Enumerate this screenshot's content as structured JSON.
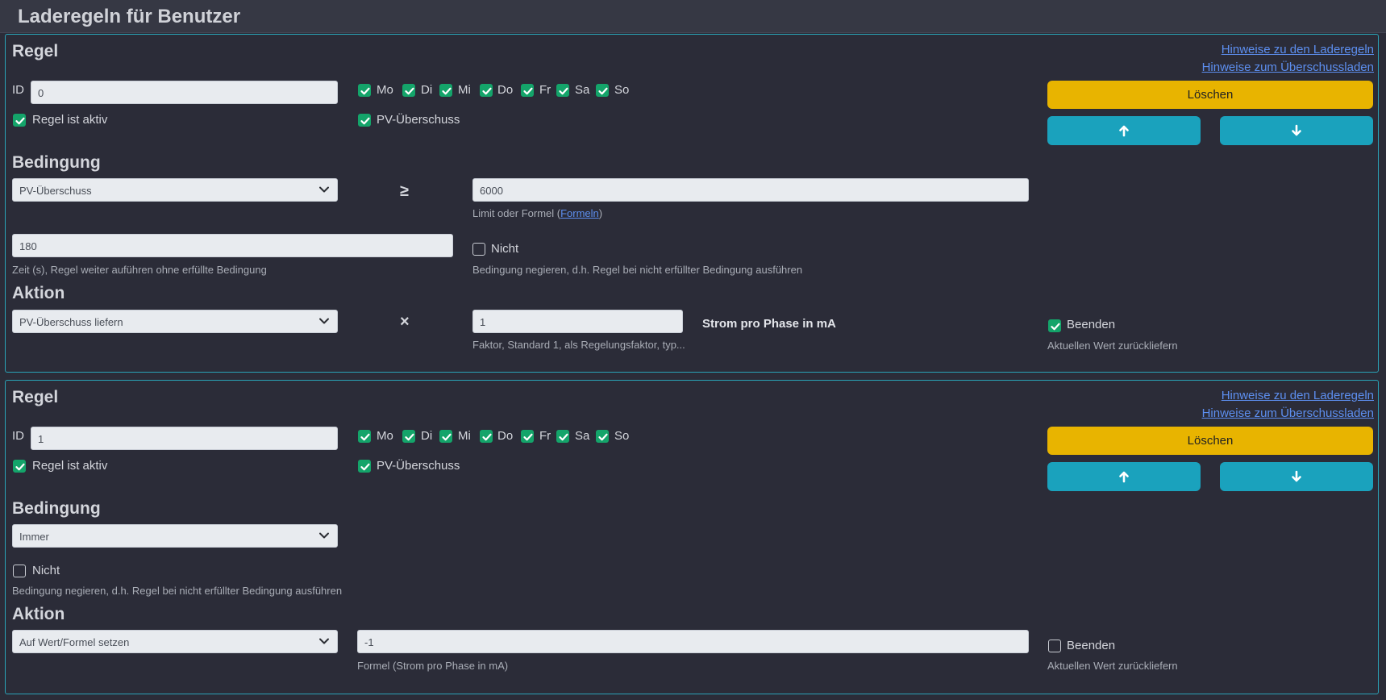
{
  "header": {
    "title": "Laderegeln für Benutzer"
  },
  "links": {
    "hints_rules": "Hinweise zu den Laderegeln",
    "hints_surplus": "Hinweise zum Überschussladen"
  },
  "days": [
    "Mo",
    "Di",
    "Mi",
    "Do",
    "Fr",
    "Sa",
    "So"
  ],
  "colors": {
    "accent_border": "#2aa3b7",
    "check_green": "#14a46a",
    "delete_yellow": "#e8b400",
    "move_cyan": "#1aa2bd",
    "link": "#5d8ff0"
  },
  "rules": [
    {
      "heading": "Regel",
      "id_label": "ID",
      "id_value": "0",
      "active_label": "Regel ist aktiv",
      "active": true,
      "pv_label": "PV-Überschuss",
      "pv_checked": true,
      "days_checked": [
        true,
        true,
        true,
        true,
        true,
        true,
        true
      ],
      "delete_label": "Löschen",
      "up_icon": "arrow-up-icon",
      "down_icon": "arrow-down-icon",
      "condition_heading": "Bedingung",
      "condition_select": "PV-Überschuss",
      "operator": "≥",
      "limit_value": "6000",
      "limit_help_prefix": "Limit oder Formel (",
      "limit_help_link": "Formeln",
      "limit_help_suffix": ")",
      "time_value": "180",
      "time_help": "Zeit (s), Regel weiter auführen ohne erfüllte Bedingung",
      "negate_label": "Nicht",
      "negate_checked": false,
      "negate_help": "Bedingung negieren, d.h. Regel bei nicht erfüllter Bedingung ausführen",
      "action_heading": "Aktion",
      "action_select": "PV-Überschuss liefern",
      "action_operator": "×",
      "factor_value": "1",
      "factor_help": "Faktor, Standard 1, als Regelungsfaktor, typ...",
      "unit_label": "Strom pro Phase in mA",
      "finish_label": "Beenden",
      "finish_checked": true,
      "finish_help": "Aktuellen Wert zurückliefern"
    },
    {
      "heading": "Regel",
      "id_label": "ID",
      "id_value": "1",
      "active_label": "Regel ist aktiv",
      "active": true,
      "pv_label": "PV-Überschuss",
      "pv_checked": true,
      "days_checked": [
        true,
        true,
        true,
        true,
        true,
        true,
        true
      ],
      "delete_label": "Löschen",
      "up_icon": "arrow-up-icon",
      "down_icon": "arrow-down-icon",
      "condition_heading": "Bedingung",
      "condition_select": "Immer",
      "negate_label": "Nicht",
      "negate_checked": false,
      "negate_help": "Bedingung negieren, d.h. Regel bei nicht erfüllter Bedingung ausführen",
      "action_heading": "Aktion",
      "action_select": "Auf Wert/Formel setzen",
      "formula_value": "-1",
      "formula_help": "Formel (Strom pro Phase in mA)",
      "finish_label": "Beenden",
      "finish_checked": false,
      "finish_help": "Aktuellen Wert zurückliefern"
    }
  ]
}
